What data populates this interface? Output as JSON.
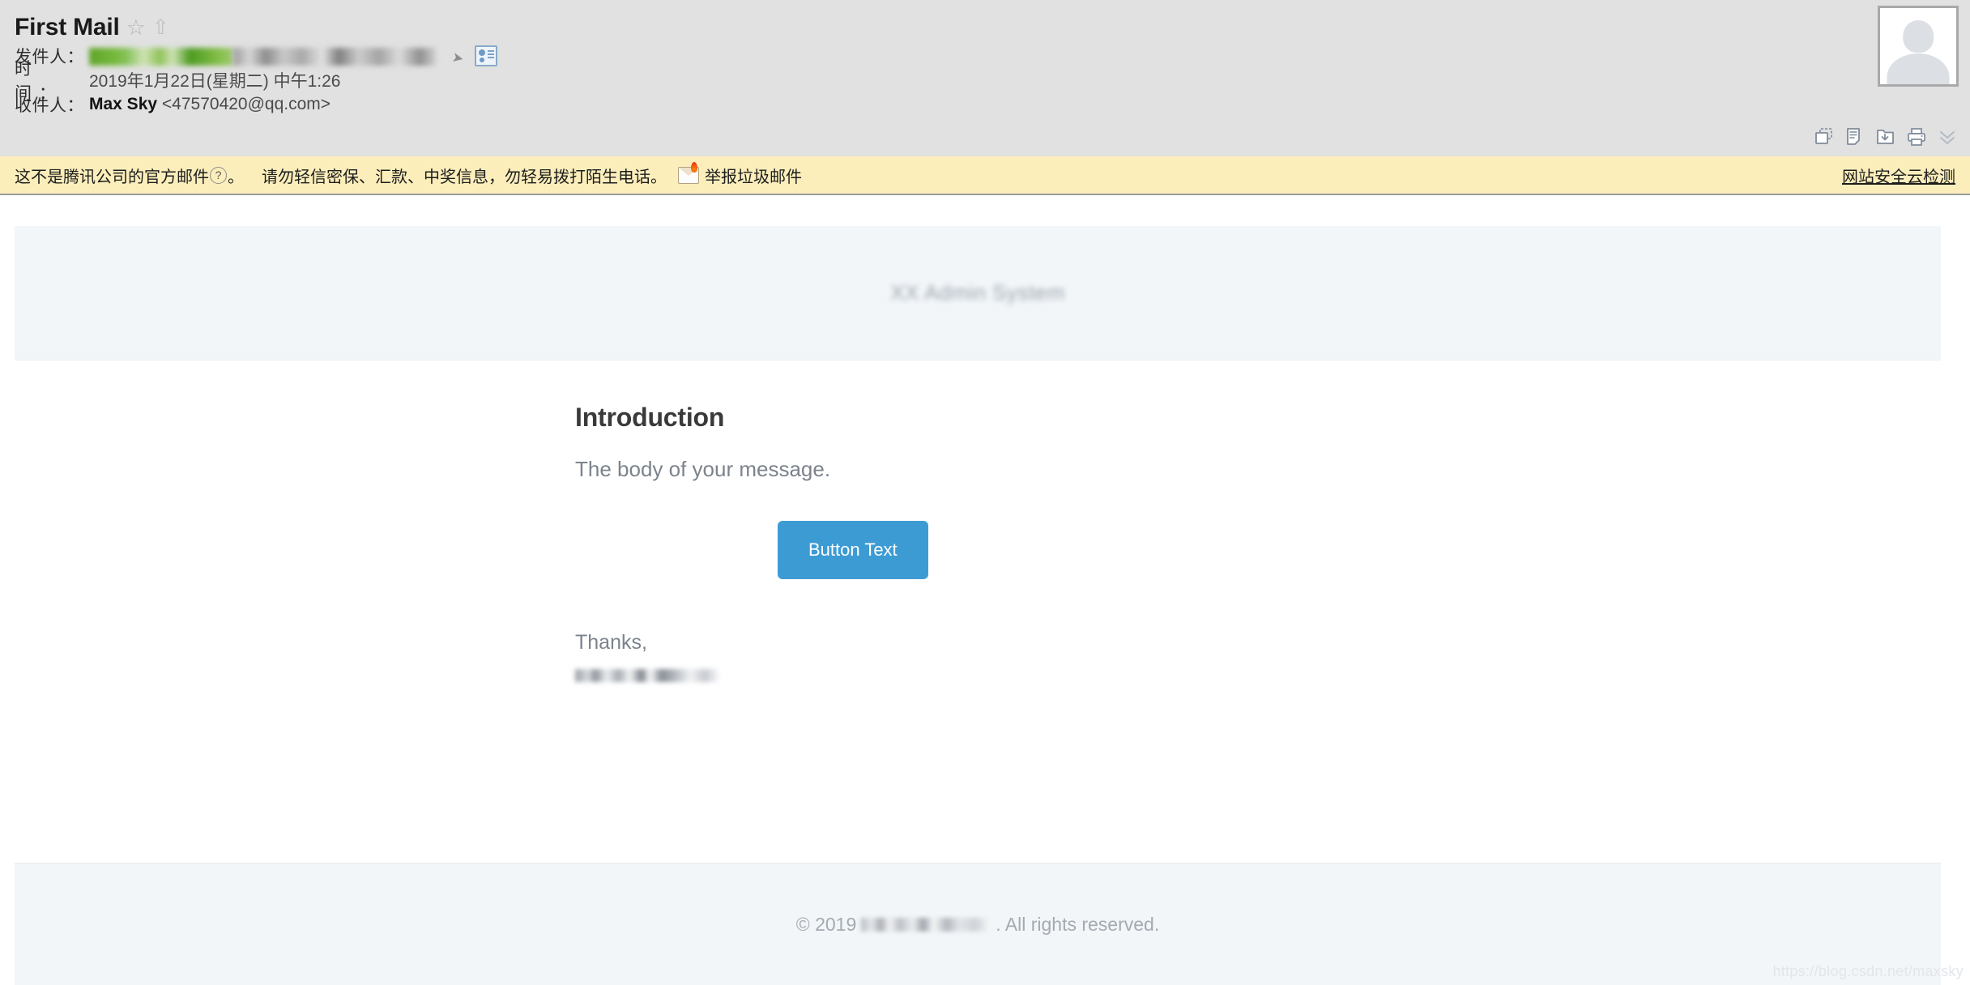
{
  "header": {
    "title": "First Mail",
    "star_icon": "star-outline-icon",
    "forward_icon": "up-arrow-outline-icon",
    "fields": [
      {
        "label": "发件人：",
        "value_redacted": true
      },
      {
        "label": "时　间：",
        "value": "2019年1月22日(星期二) 中午1:26"
      },
      {
        "label": "收件人：",
        "name": "Max Sky",
        "address": "<47570420@qq.com>"
      }
    ],
    "tools": [
      {
        "name": "open-in-new-window-icon",
        "label": "在新窗口打开"
      },
      {
        "name": "note-icon",
        "label": "记事本"
      },
      {
        "name": "download-icon",
        "label": "下载"
      },
      {
        "name": "print-icon",
        "label": "打印"
      },
      {
        "name": "chevron-double-down-icon",
        "label": "更多"
      }
    ],
    "avatar": "default-avatar"
  },
  "warning": {
    "text_before_q": "这不是腾讯公司的官方邮件",
    "q_mark": "?",
    "text_after_q": "。",
    "advice": "请勿轻信密保、汇款、中奖信息，勿轻易拨打陌生电话。",
    "report_icon": "spam-envelope-flame-icon",
    "report_link": "举报垃圾邮件",
    "right_link": "网站安全云检测"
  },
  "email": {
    "banner_logo": "XX Admin System",
    "heading": "Introduction",
    "body": "The body of your message.",
    "button_label": "Button Text",
    "thanks": "Thanks,",
    "signature_redacted": true,
    "accent_color": "#3d9bd4"
  },
  "footer": {
    "copyright_prefix": "© 2019",
    "company_redacted": true,
    "copyright_suffix": ". All rights reserved."
  },
  "watermark": "https://blog.csdn.net/maxsky"
}
